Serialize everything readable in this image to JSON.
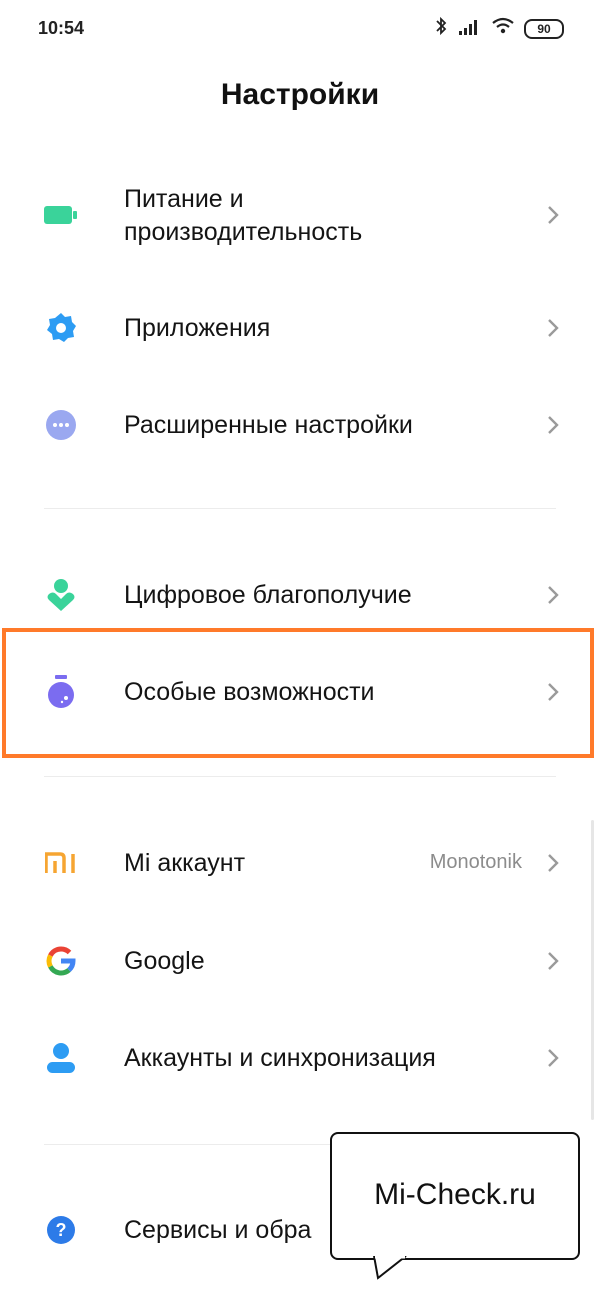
{
  "status_bar": {
    "time": "10:54",
    "battery": "90"
  },
  "header": {
    "title": "Настройки"
  },
  "rows": [
    {
      "label_line1": "Питание и",
      "label_line2": "производительность",
      "icon": "battery-icon",
      "icon_color": "#3ad39a"
    },
    {
      "label": "Приложения",
      "icon": "gear-icon",
      "icon_color": "#2d9cf3"
    },
    {
      "label": "Расширенные настройки",
      "icon": "more-dots-icon",
      "icon_color": "#9aa8f0"
    },
    {
      "label": "Цифровое благополучие",
      "icon": "wellbeing-icon",
      "icon_color": "#3ad39a"
    },
    {
      "label": "Особые возможности",
      "icon": "accessibility-flask-icon",
      "icon_color": "#7b6cf0"
    },
    {
      "label": "Mi аккаунт",
      "value": "Monotonik",
      "icon": "mi-logo-icon",
      "icon_color": "#f6a532"
    },
    {
      "label": "Google",
      "icon": "google-logo-icon"
    },
    {
      "label": "Аккаунты и синхронизация",
      "icon": "person-icon",
      "icon_color": "#2d9cf3"
    },
    {
      "label": "Сервисы и обра",
      "icon": "help-icon",
      "icon_color": "#2d7be8"
    }
  ],
  "overlay": {
    "label": "Mi-Check.ru"
  },
  "colors": {
    "highlight": "#ff7a2a"
  }
}
